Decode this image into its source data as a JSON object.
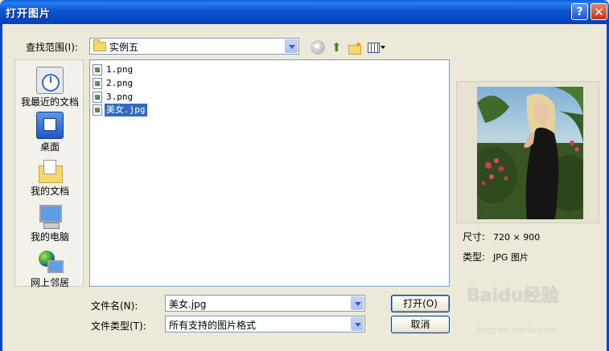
{
  "window": {
    "title": "打开图片",
    "help_glyph": "?",
    "close_glyph": "✕"
  },
  "look_in": {
    "label": "查找范围(I):",
    "value": "实例五"
  },
  "toolbar": [
    "back-icon",
    "up-folder-icon",
    "new-folder-icon",
    "view-menu-icon"
  ],
  "places": [
    {
      "label": "我最近的文档",
      "icon": "recent-documents-icon"
    },
    {
      "label": "桌面",
      "icon": "desktop-icon"
    },
    {
      "label": "我的文档",
      "icon": "my-documents-icon"
    },
    {
      "label": "我的电脑",
      "icon": "my-computer-icon"
    },
    {
      "label": "网上邻居",
      "icon": "network-places-icon"
    }
  ],
  "files": [
    {
      "name": "1.png",
      "selected": false
    },
    {
      "name": "2.png",
      "selected": false
    },
    {
      "name": "3.png",
      "selected": false
    },
    {
      "name": "美女.jpg",
      "selected": true
    }
  ],
  "preview": {
    "size_label": "尺寸:",
    "size_value": "720 × 900",
    "type_label": "类型:",
    "type_value": "JPG 图片"
  },
  "filename": {
    "label": "文件名(N):",
    "value": "美女.jpg"
  },
  "filetype": {
    "label": "文件类型(T):",
    "value": "所有支持的图片格式"
  },
  "buttons": {
    "open": "打开(O)",
    "cancel": "取消"
  },
  "watermark": {
    "brand": "Baidu经验",
    "url": "jingyan.baidu.com"
  }
}
